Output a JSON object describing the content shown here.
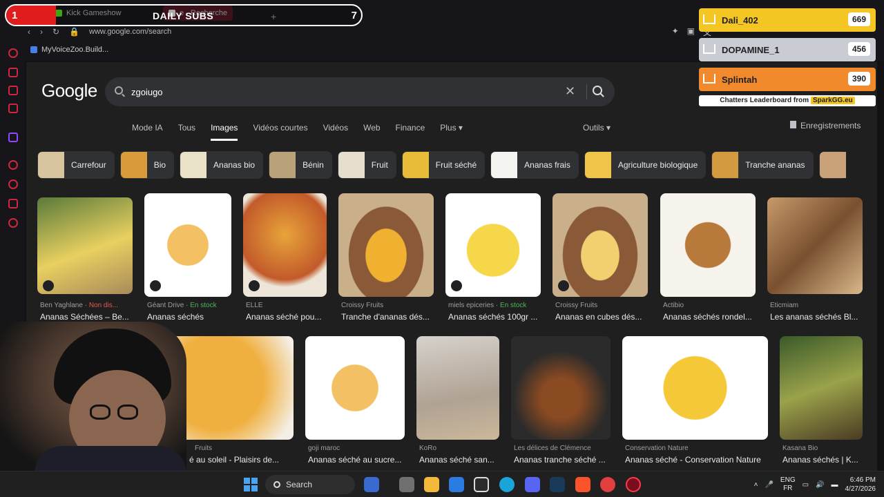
{
  "overlay": {
    "left_number": "1",
    "title": "DAILY SUBS",
    "right_number": "7"
  },
  "browser": {
    "tab1": "Kick Gameshow",
    "tab2": "e - Recherche",
    "url": "www.google.com/search",
    "bookmark": "MyVoiceZoo.Build..."
  },
  "google": {
    "logo": "Google",
    "query": "zgoiugo",
    "tabs": [
      "Mode IA",
      "Tous",
      "Images",
      "Vidéos courtes",
      "Vidéos",
      "Web",
      "Finance",
      "Plus ▾"
    ],
    "tools": "Outils ▾",
    "saved": "Enregistrements",
    "chips": [
      "Carrefour",
      "Bio",
      "Ananas bio",
      "Bénin",
      "Fruit",
      "Fruit séché",
      "Ananas frais",
      "Agriculture biologique",
      "Tranche ananas"
    ],
    "row1": [
      {
        "source": "Ben Yaghlane",
        "extra": "Non dis...",
        "extra_type": "ndisp",
        "title": "Ananas Séchées – Be..."
      },
      {
        "source": "Géant Drive",
        "extra": "En stock",
        "extra_type": "stock",
        "title": "Ananas séchés"
      },
      {
        "source": "ELLE",
        "extra": "",
        "extra_type": "",
        "title": "Ananas séché pou..."
      },
      {
        "source": "Croissy Fruits",
        "extra": "",
        "extra_type": "",
        "title": "Tranche d'ananas dés..."
      },
      {
        "source": "miels epiceries",
        "extra": "En stock",
        "extra_type": "stock",
        "title": "Ananas séchés 100gr ..."
      },
      {
        "source": "Croissy Fruits",
        "extra": "",
        "extra_type": "",
        "title": "Ananas en cubes dés..."
      },
      {
        "source": "Actibio",
        "extra": "",
        "extra_type": "",
        "title": "Ananas séchés rondel..."
      },
      {
        "source": "Eticmiam",
        "extra": "",
        "extra_type": "",
        "title": "Les ananas séchés Bl..."
      }
    ],
    "row2": [
      {
        "source": "Fruits",
        "title": "é au soleil - Plaisirs de..."
      },
      {
        "source": "goji maroc",
        "title": "Ananas séché au sucre..."
      },
      {
        "source": "KoRo",
        "title": "Ananas séché san..."
      },
      {
        "source": "Les délices de Clémence",
        "title": "Ananas tranche séché ..."
      },
      {
        "source": "Conservation Nature",
        "title": "Ananas séché - Conservation Nature"
      },
      {
        "source": "Kasana Bio",
        "title": "Ananas séchés | K..."
      }
    ]
  },
  "leaderboard": {
    "rows": [
      {
        "name": "Dali_402",
        "score": "669",
        "color": "#f3c623"
      },
      {
        "name": "DOPAMINE_1",
        "score": "456",
        "color": "#c9ccd3"
      },
      {
        "name": "Splintah",
        "score": "390",
        "color": "#f08a2c"
      }
    ],
    "footer_prefix": "Chatters Leaderboard from",
    "footer_brand": "SparkGG.eu"
  },
  "taskbar": {
    "search": "Search",
    "lang_line1": "ENG",
    "lang_line2": "FR",
    "time": "6:46 PM",
    "date": "4/27/2026"
  }
}
